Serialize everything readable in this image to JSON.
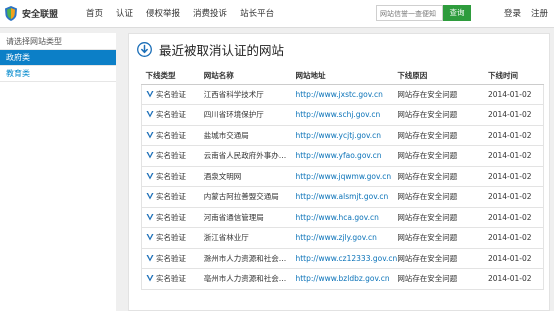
{
  "header": {
    "logo_text": "安全联盟",
    "nav": [
      "首页",
      "认证",
      "侵权举报",
      "消费投诉",
      "站长平台"
    ],
    "search_placeholder": "网站信誉一查便知",
    "search_button": "查询",
    "login": "登录",
    "register": "注册"
  },
  "sidebar": {
    "title": "请选择网站类型",
    "items": [
      {
        "label": "政府类"
      },
      {
        "label": "教育类"
      }
    ]
  },
  "main": {
    "title": "最近被取消认证的网站",
    "columns": [
      "下线类型",
      "网站名称",
      "网站地址",
      "下线原因",
      "下线时间"
    ],
    "rows": [
      {
        "type": "实名验证",
        "name": "江西省科学技术厅",
        "url": "http://www.jxstc.gov.cn",
        "reason": "网站存在安全问题",
        "date": "2014-01-02"
      },
      {
        "type": "实名验证",
        "name": "四川省环境保护厅",
        "url": "http://www.schj.gov.cn",
        "reason": "网站存在安全问题",
        "date": "2014-01-02"
      },
      {
        "type": "实名验证",
        "name": "盐城市交通局",
        "url": "http://www.ycjtj.gov.cn",
        "reason": "网站存在安全问题",
        "date": "2014-01-02"
      },
      {
        "type": "实名验证",
        "name": "云南省人民政府外事办公室",
        "url": "http://www.yfao.gov.cn",
        "reason": "网站存在安全问题",
        "date": "2014-01-02"
      },
      {
        "type": "实名验证",
        "name": "酒泉文明网",
        "url": "http://www.jqwmw.gov.cn",
        "reason": "网站存在安全问题",
        "date": "2014-01-02"
      },
      {
        "type": "实名验证",
        "name": "内蒙古阿拉善盟交通局",
        "url": "http://www.alsmjt.gov.cn",
        "reason": "网站存在安全问题",
        "date": "2014-01-02"
      },
      {
        "type": "实名验证",
        "name": "河南省通信管理局",
        "url": "http://www.hca.gov.cn",
        "reason": "网站存在安全问题",
        "date": "2014-01-02"
      },
      {
        "type": "实名验证",
        "name": "浙江省林业厅",
        "url": "http://www.zjly.gov.cn",
        "reason": "网站存在安全问题",
        "date": "2014-01-02"
      },
      {
        "type": "实名验证",
        "name": "滁州市人力资源和社会保...",
        "url": "http://www.cz12333.gov.cn",
        "reason": "网站存在安全问题",
        "date": "2014-01-02"
      },
      {
        "type": "实名验证",
        "name": "亳州市人力资源和社会保...",
        "url": "http://www.bzldbz.gov.cn",
        "reason": "网站存在安全问题",
        "date": "2014-01-02"
      }
    ]
  },
  "colors": {
    "accent_green": "#2e9c3d",
    "active_blue": "#0c7fc7",
    "link_blue": "#0a72b8"
  }
}
